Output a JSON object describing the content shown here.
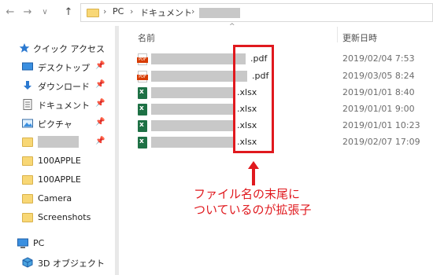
{
  "address": {
    "crumbs": [
      "PC",
      "ドキュメント"
    ],
    "separator": "›"
  },
  "nav": {
    "back": "←",
    "forward": "→",
    "recent": "∨",
    "up": "↑"
  },
  "sidebar": {
    "pin": "📌",
    "items": [
      {
        "label": "クイック アクセス",
        "icon": "star-icon",
        "pinned": false
      },
      {
        "label": "デスクトップ",
        "icon": "desktop-icon",
        "pinned": true
      },
      {
        "label": "ダウンロード",
        "icon": "download-icon",
        "pinned": true
      },
      {
        "label": "ドキュメント",
        "icon": "document-icon",
        "pinned": true
      },
      {
        "label": "ピクチャ",
        "icon": "pictures-icon",
        "pinned": true
      },
      {
        "label": "",
        "icon": "folder-icon",
        "pinned": true
      },
      {
        "label": "100APPLE",
        "icon": "folder-icon",
        "pinned": false
      },
      {
        "label": "100APPLE",
        "icon": "folder-icon",
        "pinned": false
      },
      {
        "label": "Camera",
        "icon": "folder-icon",
        "pinned": false
      },
      {
        "label": "Screenshots",
        "icon": "folder-icon",
        "pinned": false
      },
      {
        "label": "PC",
        "icon": "pc-icon",
        "pinned": false
      },
      {
        "label": "3D オブジェクト",
        "icon": "3d-objects-icon",
        "pinned": false
      }
    ]
  },
  "columns": {
    "name": "名前",
    "modified": "更新日時",
    "sort_arrow": "^"
  },
  "files": [
    {
      "ext": ".pdf",
      "type": "pdf",
      "date": "2019/02/04 7:53"
    },
    {
      "ext": ".pdf",
      "type": "pdf",
      "date": "2019/03/05 8:24"
    },
    {
      "ext": ".xlsx",
      "type": "excel",
      "date": "2019/01/01 8:40"
    },
    {
      "ext": ".xlsx",
      "type": "excel",
      "date": "2019/01/01 9:00"
    },
    {
      "ext": ".xlsx",
      "type": "excel",
      "date": "2019/01/01 10:23"
    },
    {
      "ext": ".xlsx",
      "type": "excel",
      "date": "2019/02/07 17:09"
    }
  ],
  "annotation": {
    "line1": "ファイル名の末尾に",
    "line2": "ついているのが拡張子",
    "color": "#e0191e"
  },
  "colors": {
    "accent": "#e0191e",
    "folder": "#f8d775",
    "excel": "#1e7145",
    "pdf": "#d83b01"
  }
}
